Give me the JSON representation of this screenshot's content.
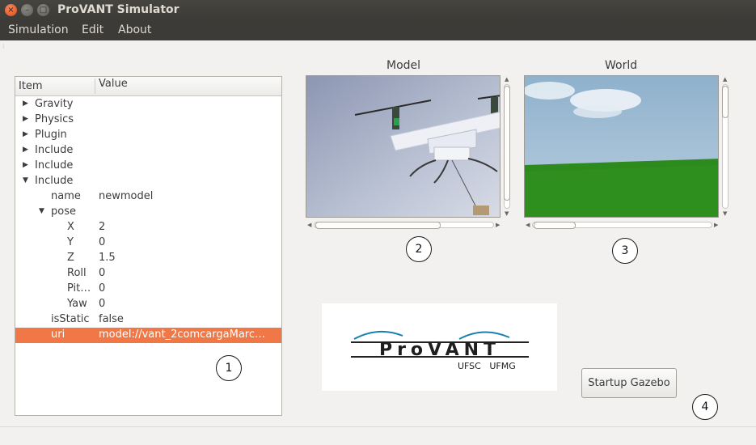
{
  "window": {
    "title": "ProVANT Simulator",
    "close_glyph": "×",
    "min_glyph": "–",
    "max_glyph": "□"
  },
  "menu": {
    "items": [
      "Simulation",
      "Edit",
      "About"
    ]
  },
  "tree": {
    "columns": [
      "Item",
      "Value"
    ],
    "rows": [
      {
        "label": "Gravity",
        "value": "",
        "depth": 0,
        "arrow": "▶"
      },
      {
        "label": "Physics",
        "value": "",
        "depth": 0,
        "arrow": "▶"
      },
      {
        "label": "Plugin",
        "value": "",
        "depth": 0,
        "arrow": "▶"
      },
      {
        "label": "Include",
        "value": "",
        "depth": 0,
        "arrow": "▶"
      },
      {
        "label": "Include",
        "value": "",
        "depth": 0,
        "arrow": "▶"
      },
      {
        "label": "Include",
        "value": "",
        "depth": 0,
        "arrow": "▼"
      },
      {
        "label": "name",
        "value": "newmodel",
        "depth": 1,
        "arrow": ""
      },
      {
        "label": "pose",
        "value": "",
        "depth": 1,
        "arrow": "▼"
      },
      {
        "label": "X",
        "value": "2",
        "depth": 2,
        "arrow": ""
      },
      {
        "label": "Y",
        "value": "0",
        "depth": 2,
        "arrow": ""
      },
      {
        "label": "Z",
        "value": "1.5",
        "depth": 2,
        "arrow": ""
      },
      {
        "label": "Roll",
        "value": "0",
        "depth": 2,
        "arrow": ""
      },
      {
        "label": "Pit…",
        "value": "0",
        "depth": 2,
        "arrow": ""
      },
      {
        "label": "Yaw",
        "value": "0",
        "depth": 2,
        "arrow": ""
      },
      {
        "label": "isStatic",
        "value": "false",
        "depth": 1,
        "arrow": ""
      },
      {
        "label": "uri",
        "value": "model://vant_2comcargaMarc…",
        "depth": 1,
        "arrow": "",
        "selected": true
      }
    ]
  },
  "panels": {
    "model_label": "Model",
    "world_label": "World"
  },
  "logo": {
    "text": "ProVANT",
    "subtitle": "UFSC   UFMG"
  },
  "startup_button": "Startup Gazebo",
  "callouts": [
    "1",
    "2",
    "3",
    "4"
  ],
  "colors": {
    "selection": "#f07746",
    "titlebar": "#3c3b37",
    "close_button": "#df4a16",
    "world_grass": "#2d8a1c",
    "world_sky": "#9fc0d8"
  },
  "scroll_glyphs": {
    "up": "▲",
    "down": "▼",
    "left": "◀",
    "right": "▶",
    "grip": "⁝"
  }
}
